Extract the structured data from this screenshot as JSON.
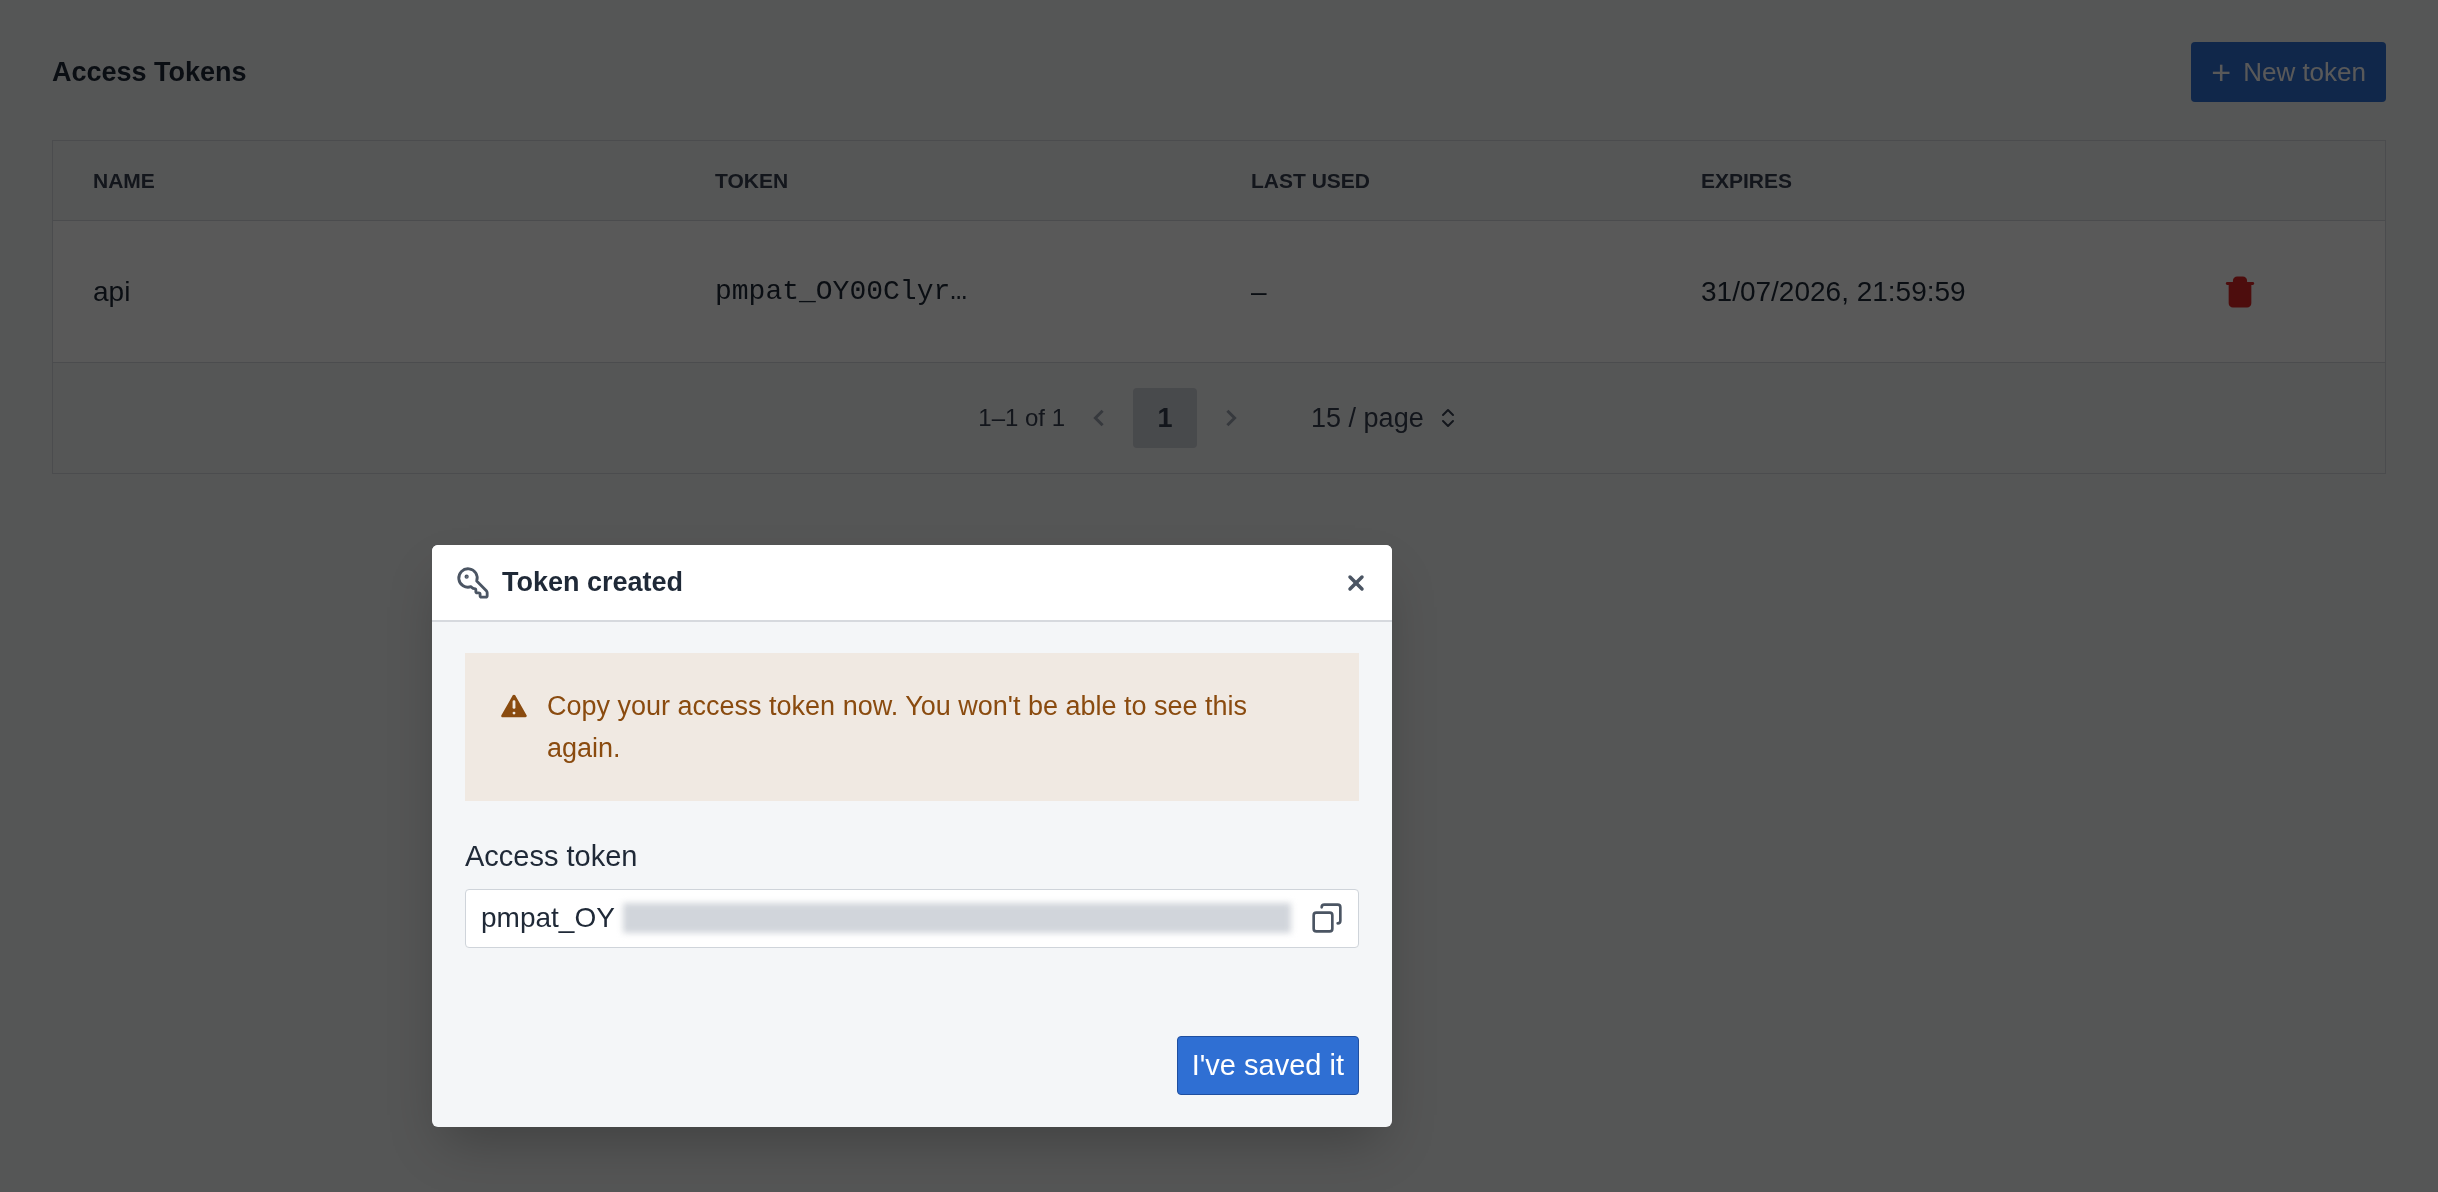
{
  "page": {
    "title": "Access Tokens",
    "new_button": {
      "icon": "+",
      "label": "New token"
    }
  },
  "table": {
    "columns": [
      "NAME",
      "TOKEN",
      "LAST USED",
      "EXPIRES"
    ],
    "rows": [
      {
        "name": "api",
        "token": "pmpat_OY00Clyr…",
        "last_used": "–",
        "expires": "31/07/2026, 21:59:59"
      }
    ]
  },
  "pagination": {
    "range": "1–1 of 1",
    "pages": [
      {
        "label": "1",
        "selected": true
      }
    ],
    "page_size": "15 / page"
  },
  "dialog": {
    "title": "Token created",
    "warning": "Copy your access token now. You won't be able to see this again.",
    "field_label": "Access token",
    "field_value": "pmpat_OY",
    "button": "I've saved it"
  }
}
